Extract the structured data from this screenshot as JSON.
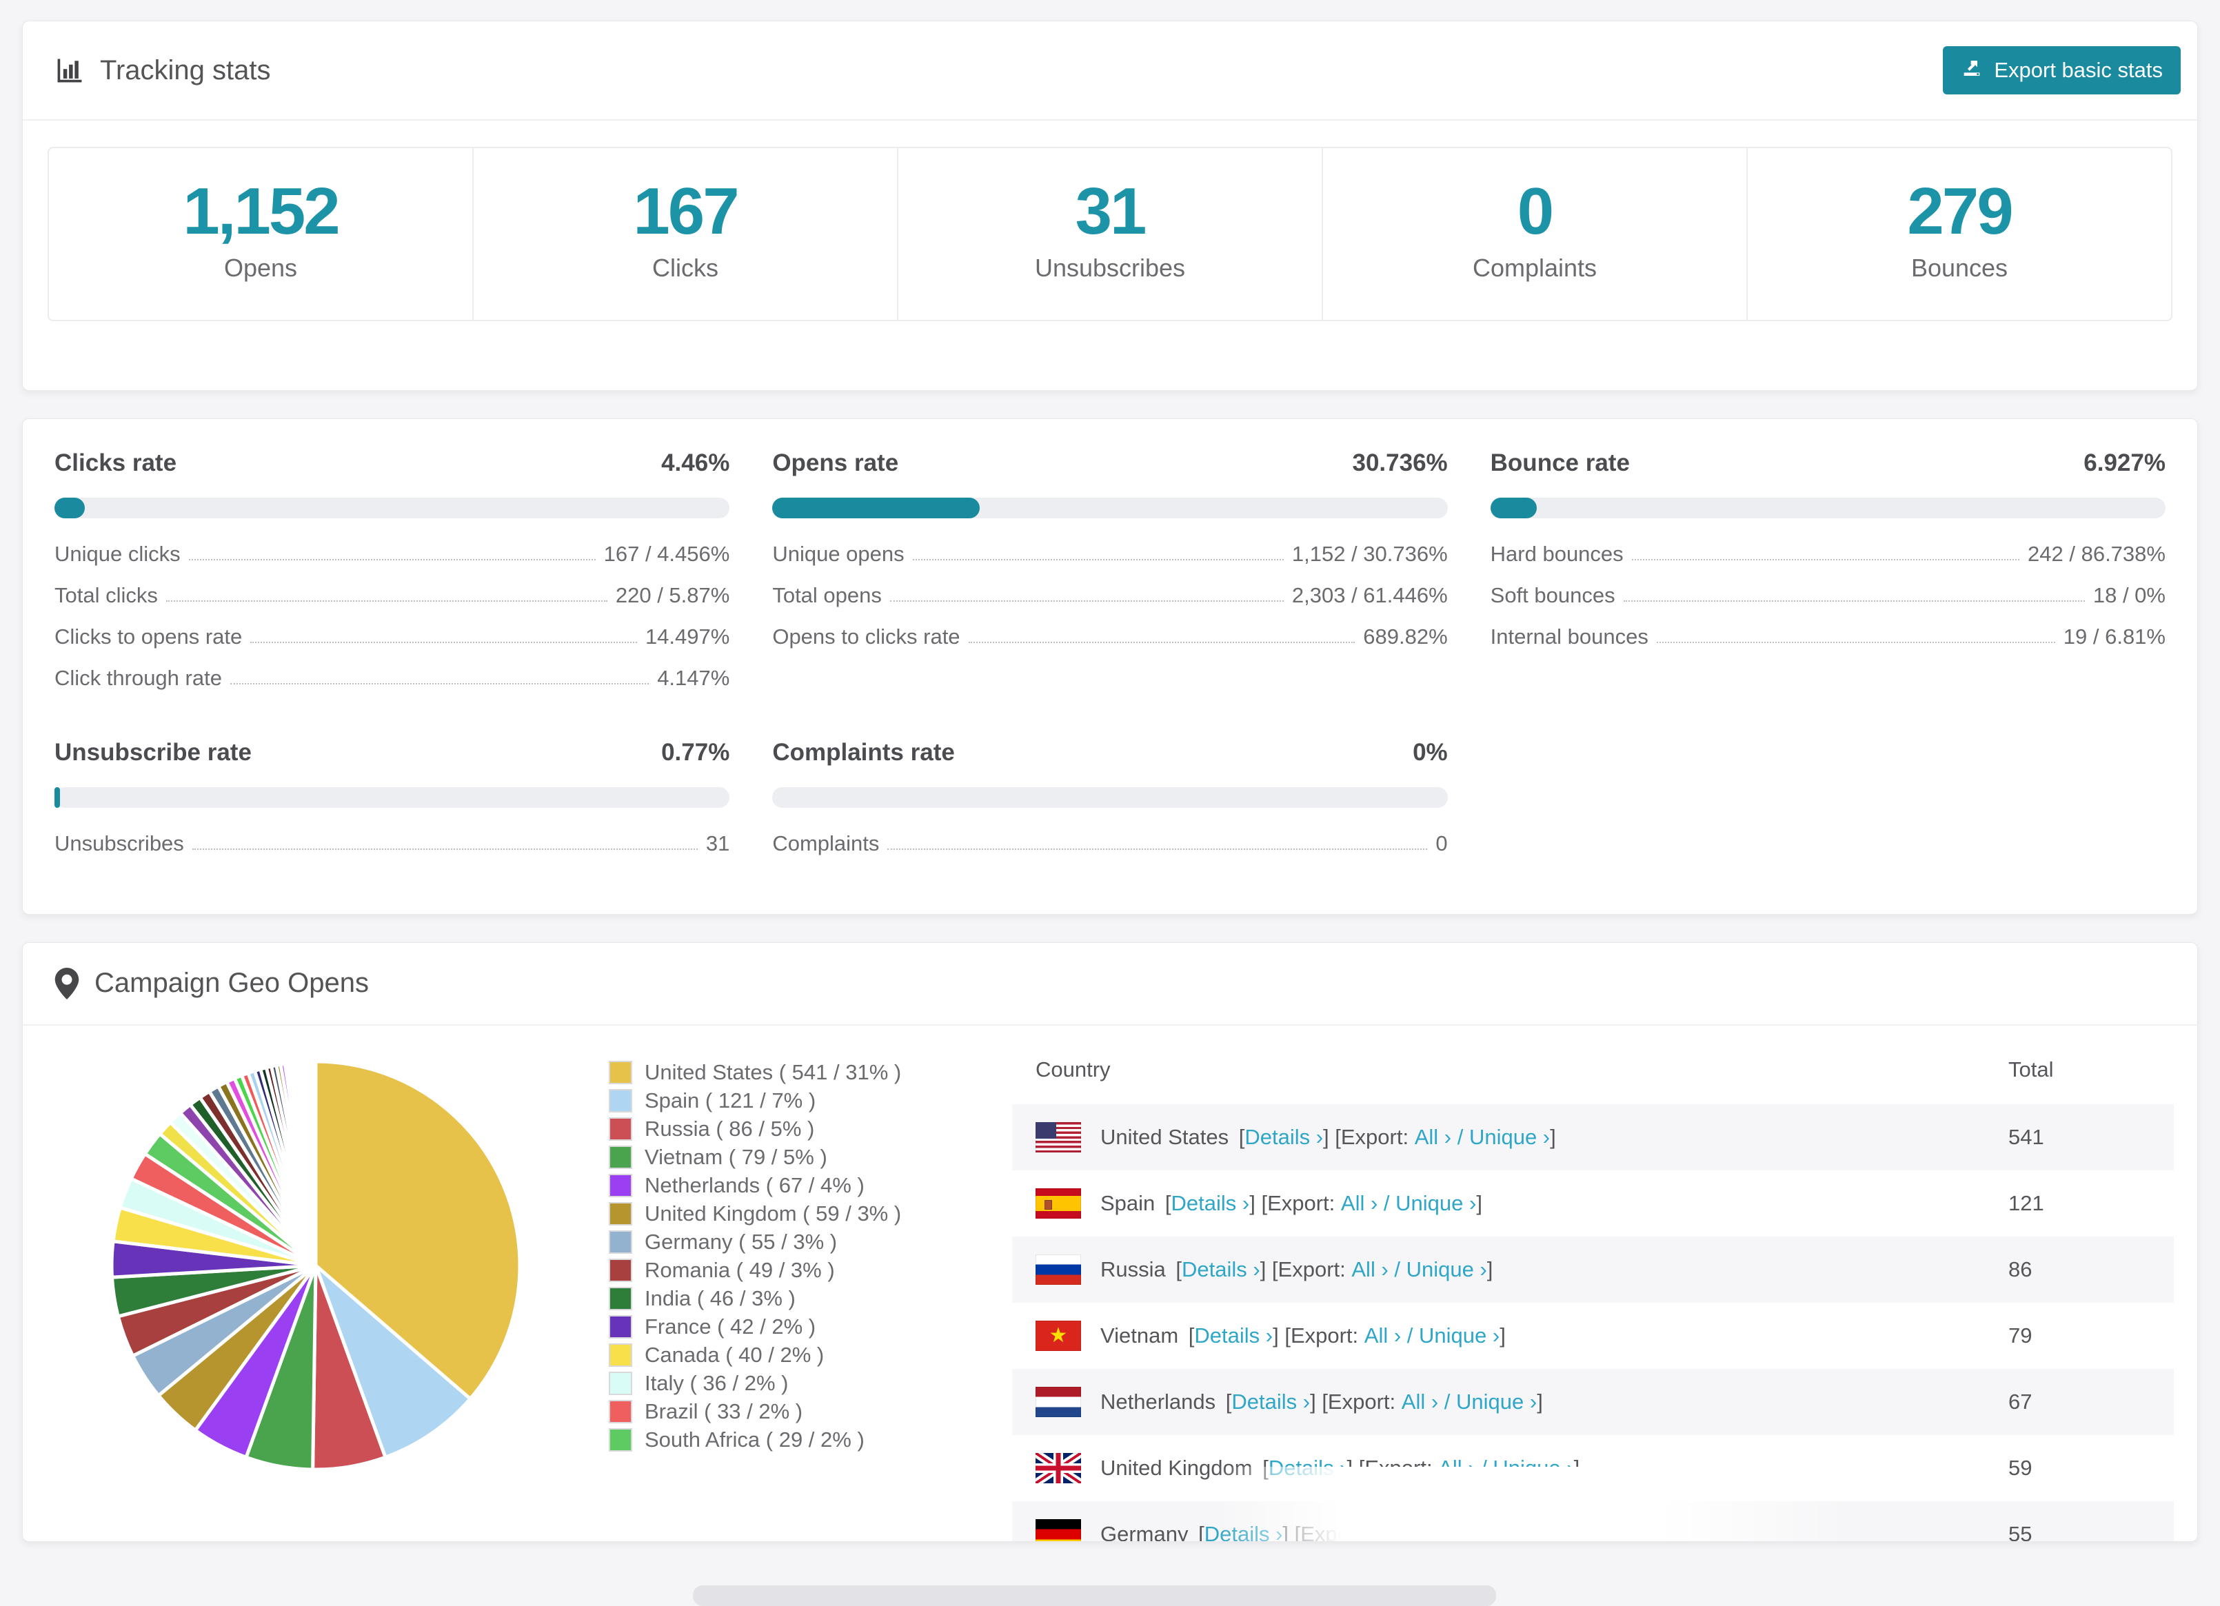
{
  "colors": {
    "accent": "#1a8a9f",
    "stat_number": "#1d93a8",
    "link": "#2ea6c7"
  },
  "tracking": {
    "title": "Tracking stats",
    "export_label": "Export basic stats",
    "stats": [
      {
        "value": "1,152",
        "label": "Opens"
      },
      {
        "value": "167",
        "label": "Clicks"
      },
      {
        "value": "31",
        "label": "Unsubscribes"
      },
      {
        "value": "0",
        "label": "Complaints"
      },
      {
        "value": "279",
        "label": "Bounces"
      }
    ]
  },
  "rates": {
    "blocks": [
      {
        "title": "Clicks rate",
        "value": "4.46%",
        "percent": 4.46,
        "rows": [
          {
            "label": "Unique clicks",
            "value": "167 / 4.456%"
          },
          {
            "label": "Total clicks",
            "value": "220 / 5.87%"
          },
          {
            "label": "Clicks to opens rate",
            "value": "14.497%"
          },
          {
            "label": "Click through rate",
            "value": "4.147%"
          }
        ]
      },
      {
        "title": "Opens rate",
        "value": "30.736%",
        "percent": 30.736,
        "rows": [
          {
            "label": "Unique opens",
            "value": "1,152 / 30.736%"
          },
          {
            "label": "Total opens",
            "value": "2,303 / 61.446%"
          },
          {
            "label": "Opens to clicks rate",
            "value": "689.82%"
          }
        ]
      },
      {
        "title": "Bounce rate",
        "value": "6.927%",
        "percent": 6.927,
        "rows": [
          {
            "label": "Hard bounces",
            "value": "242 / 86.738%"
          },
          {
            "label": "Soft bounces",
            "value": "18 / 0%"
          },
          {
            "label": "Internal bounces",
            "value": "19 / 6.81%"
          }
        ]
      },
      {
        "title": "Unsubscribe rate",
        "value": "0.77%",
        "percent": 0.77,
        "rows": [
          {
            "label": "Unsubscribes",
            "value": "31"
          }
        ]
      },
      {
        "title": "Complaints rate",
        "value": "0%",
        "percent": 0,
        "rows": [
          {
            "label": "Complaints",
            "value": "0"
          }
        ]
      }
    ]
  },
  "geo": {
    "title": "Campaign Geo Opens",
    "table": {
      "header_country": "Country",
      "header_total": "Total",
      "open_bracket": " [",
      "link_details": "Details ›",
      "close_export": "] [Export: ",
      "link_all": "All ›",
      "slash": " / ",
      "link_unique": "Unique ›",
      "close_bracket": "]",
      "rows": [
        {
          "country": "United States",
          "total": "541"
        },
        {
          "country": "Spain",
          "total": "121"
        },
        {
          "country": "Russia",
          "total": "86"
        },
        {
          "country": "Vietnam",
          "total": "79"
        },
        {
          "country": "Netherlands",
          "total": "67"
        },
        {
          "country": "United Kingdom",
          "total": "59"
        },
        {
          "country": "Germany",
          "total": "55"
        }
      ]
    }
  },
  "chart_data": {
    "type": "pie",
    "title": "Campaign Geo Opens",
    "legend_position": "right",
    "labels": [
      "United States",
      "Spain",
      "Russia",
      "Vietnam",
      "Netherlands",
      "United Kingdom",
      "Germany",
      "Romania",
      "India",
      "France",
      "Canada",
      "Italy",
      "Brazil",
      "South Africa"
    ],
    "values": [
      541,
      121,
      86,
      79,
      67,
      59,
      55,
      49,
      46,
      42,
      40,
      36,
      33,
      29
    ],
    "percent_labels": [
      "31%",
      "7%",
      "5%",
      "5%",
      "4%",
      "3%",
      "3%",
      "3%",
      "3%",
      "2%",
      "2%",
      "2%",
      "2%",
      "2%"
    ],
    "colors": [
      "#e7c24b",
      "#aed5f2",
      "#cc4f55",
      "#4aa44e",
      "#9b3ff2",
      "#b6952f",
      "#92b2cf",
      "#a8403f",
      "#2e7d39",
      "#6733b8",
      "#f7e04a",
      "#d9fcf6",
      "#f05f5f",
      "#5ecb62"
    ],
    "legend_texts": [
      "United States ( 541 / 31% )",
      "Spain ( 121 / 7% )",
      "Russia ( 86 / 5% )",
      "Vietnam ( 79 / 5% )",
      "Netherlands ( 67 / 4% )",
      "United Kingdom ( 59 / 3% )",
      "Germany ( 55 / 3% )",
      "Romania ( 49 / 3% )",
      "India ( 46 / 3% )",
      "France ( 42 / 2% )",
      "Canada ( 40 / 2% )",
      "Italy ( 36 / 2% )",
      "Brazil ( 33 / 2% )",
      "South Africa ( 29 / 2% )"
    ],
    "others_values": [
      18,
      16,
      15,
      14,
      13,
      12,
      11,
      10,
      9,
      8,
      8,
      7,
      7,
      6,
      6,
      5,
      5,
      4,
      4,
      3,
      3,
      3,
      2,
      2,
      2,
      2,
      2,
      1,
      1,
      1,
      1,
      1,
      1,
      1,
      1,
      1
    ],
    "others_colors": [
      "#f0e14a",
      "#e8fefb",
      "#8e44ad",
      "#1e5f2a",
      "#7c2f2c",
      "#5d7a92",
      "#8a7420",
      "#e04fe0",
      "#4cd44c",
      "#f05a5a",
      "#a8d2f0",
      "#2c2c78",
      "#123524",
      "#5b1f1f",
      "#475569",
      "#9a8428",
      "#b44fe0",
      "#37d437",
      "#fd5d5d",
      "#ffff4d",
      "#eefcfa",
      "#5b2d91",
      "#1e6b30",
      "#8b3a38",
      "#64748b",
      "#a08a2a",
      "#d45fe8",
      "#4ae04a",
      "#ff6b6b",
      "#bcdcf5",
      "#343488",
      "#1a4a2a",
      "#6b2a2a",
      "#527088",
      "#9a8428",
      "#e060c0"
    ]
  }
}
